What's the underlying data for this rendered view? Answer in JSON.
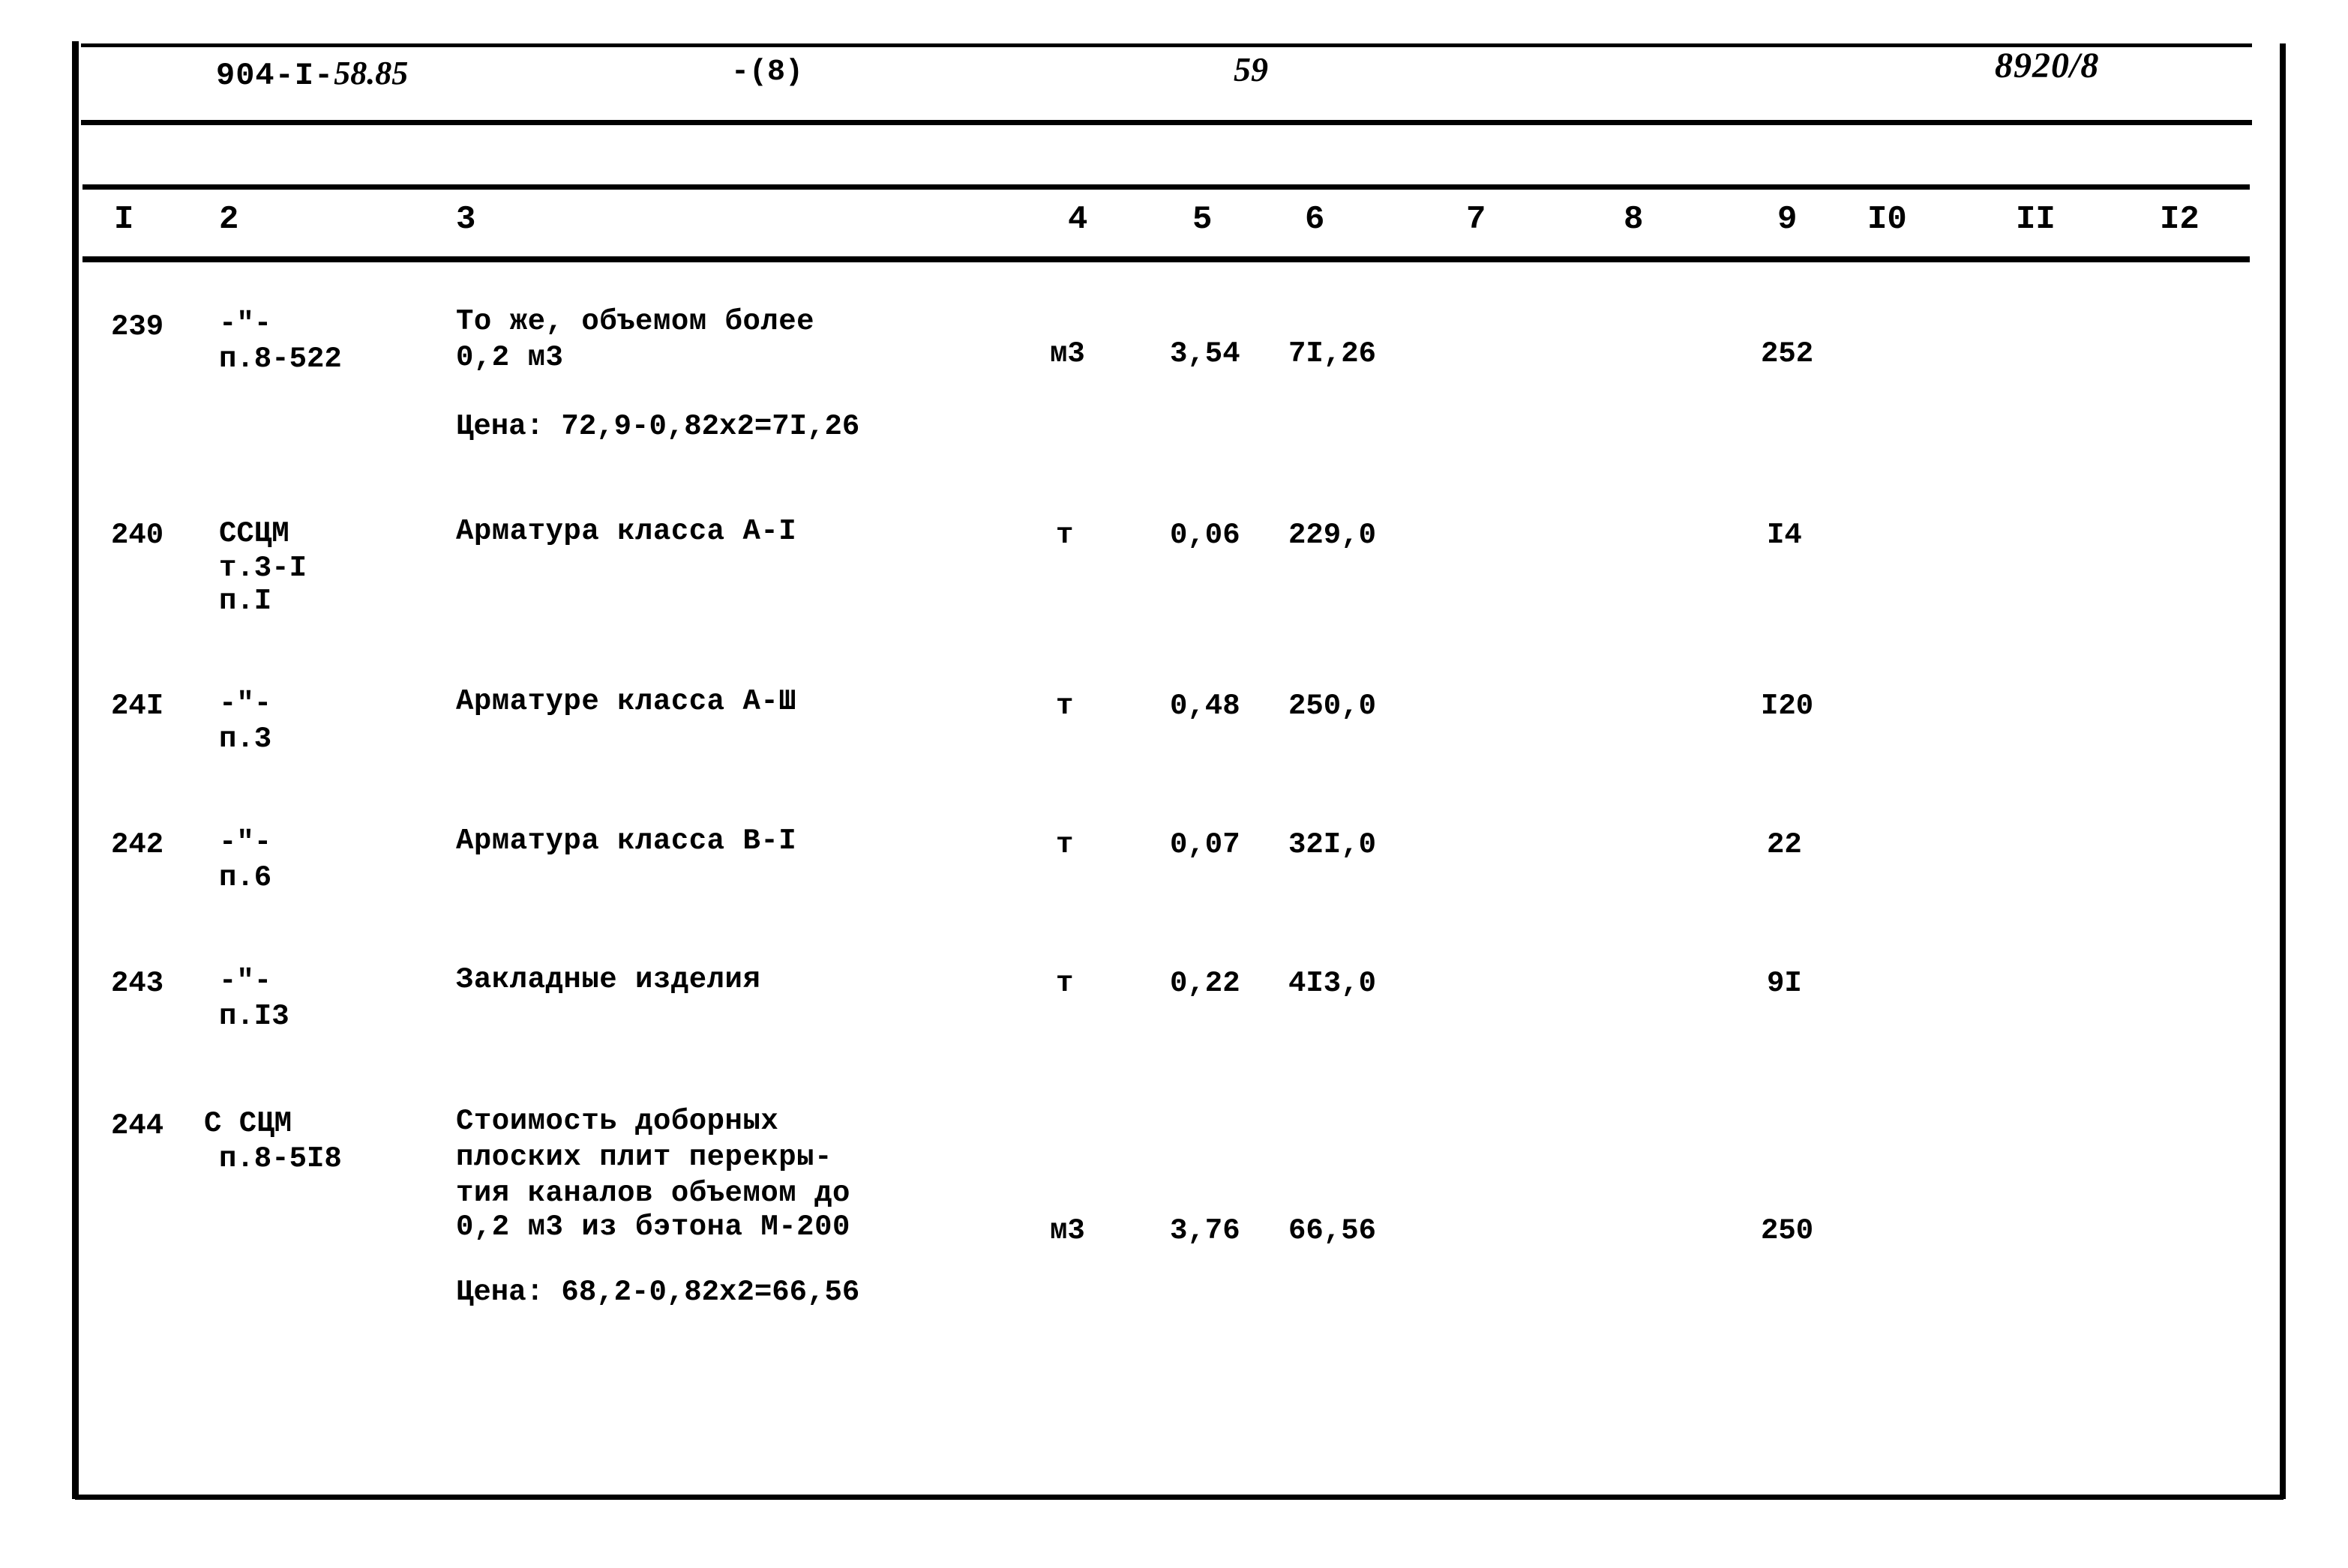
{
  "header": {
    "doc_code_printed": "904-I-",
    "doc_code_hand": "58.85",
    "sheet_ref": "-(8)",
    "page_number": "59",
    "doc_number": "8920/8"
  },
  "table": {
    "column_numbers": [
      "I",
      "2",
      "3",
      "4",
      "5",
      "6",
      "7",
      "8",
      "9",
      "I0",
      "II",
      "I2"
    ],
    "rows": [
      {
        "pos": "239",
        "ref_line1": "-\"-",
        "ref_line2": "п.8-522",
        "desc_line1": "То же, объемом более",
        "desc_line2": "0,2 м3",
        "note": "Цена: 72,9-0,82x2=7I,26",
        "unit": "м3",
        "qty": "3,54",
        "price": "7I,26",
        "col7": "",
        "col8": "",
        "col9": "252",
        "col10": "",
        "col11": "",
        "col12": ""
      },
      {
        "pos": "240",
        "ref_line1": "ССЦМ",
        "ref_line2": "т.3-I",
        "ref_line3": "п.I",
        "desc_line1": "Арматура класса А-I",
        "note": "",
        "unit": "т",
        "qty": "0,06",
        "price": "229,0",
        "col7": "",
        "col8": "",
        "col9": "I4",
        "col10": "",
        "col11": "",
        "col12": ""
      },
      {
        "pos": "24I",
        "ref_line1": "-\"-",
        "ref_line2": "п.3",
        "desc_line1": "Арматуре класса А-Ш",
        "note": "",
        "unit": "т",
        "qty": "0,48",
        "price": "250,0",
        "col7": "",
        "col8": "",
        "col9": "I20",
        "col10": "",
        "col11": "",
        "col12": ""
      },
      {
        "pos": "242",
        "ref_line1": "-\"-",
        "ref_line2": "п.6",
        "desc_line1": "Арматура класса В-I",
        "note": "",
        "unit": "т",
        "qty": "0,07",
        "price": "32I,0",
        "col7": "",
        "col8": "",
        "col9": "22",
        "col10": "",
        "col11": "",
        "col12": ""
      },
      {
        "pos": "243",
        "ref_line1": "-\"-",
        "ref_line2": "п.I3",
        "desc_line1": "Закладные изделия",
        "note": "",
        "unit": "т",
        "qty": "0,22",
        "price": "4I3,0",
        "col7": "",
        "col8": "",
        "col9": "9I",
        "col10": "",
        "col11": "",
        "col12": ""
      },
      {
        "pos": "244",
        "ref_line1": "С СЦМ",
        "ref_line2": "п.8-5I8",
        "desc_line1": "Стоимость доборных",
        "desc_line2": "плоских плит перекры-",
        "desc_line3": "тия каналов объемом до",
        "desc_line4": "0,2 м3 из бэтона М-200",
        "note": "Цена: 68,2-0,82x2=66,56",
        "unit": "м3",
        "qty": "3,76",
        "price": "66,56",
        "col7": "",
        "col8": "",
        "col9": "250",
        "col10": "",
        "col11": "",
        "col12": ""
      }
    ]
  }
}
